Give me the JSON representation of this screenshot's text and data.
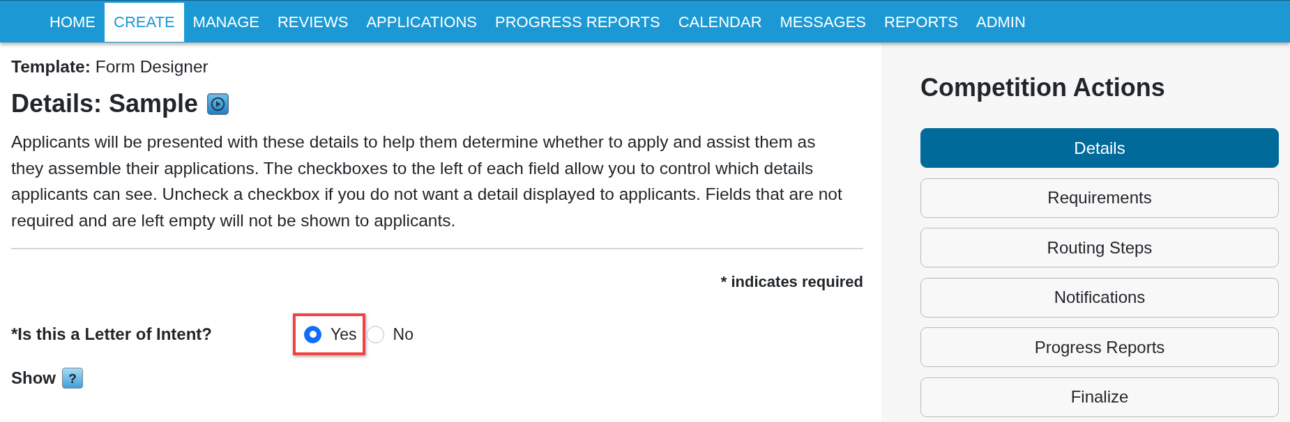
{
  "nav": {
    "items": [
      {
        "label": "HOME",
        "selected": false
      },
      {
        "label": "CREATE",
        "selected": true
      },
      {
        "label": "MANAGE",
        "selected": false
      },
      {
        "label": "REVIEWS",
        "selected": false
      },
      {
        "label": "APPLICATIONS",
        "selected": false
      },
      {
        "label": "PROGRESS REPORTS",
        "selected": false
      },
      {
        "label": "CALENDAR",
        "selected": false
      },
      {
        "label": "MESSAGES",
        "selected": false
      },
      {
        "label": "REPORTS",
        "selected": false
      },
      {
        "label": "ADMIN",
        "selected": false
      }
    ]
  },
  "template": "**Template:** Form Designer",
  "page_title": "Details: Sample",
  "intro": "Applicants will be presented with these details to help them determine whether to apply and assist them as they assemble their applications. The checkboxes to the left of each field allow you to control which details applicants can see. Uncheck a checkbox if you do not want a detail displayed to applicants. Fields that are not required and are left empty will not be shown to applicants.",
  "required_note": "* indicates required",
  "question": {
    "label": "*Is this a Letter of Intent?",
    "options": [
      {
        "label": "Yes",
        "selected": true,
        "highlighted": true
      },
      {
        "label": "No",
        "selected": false,
        "highlighted": false
      }
    ]
  },
  "show": {
    "label": "Show",
    "help": "?"
  },
  "sidebar": {
    "title": "Competition Actions",
    "items": [
      {
        "label": "Details",
        "selected": true
      },
      {
        "label": "Requirements",
        "selected": false
      },
      {
        "label": "Routing Steps",
        "selected": false
      },
      {
        "label": "Notifications",
        "selected": false
      },
      {
        "label": "Progress Reports",
        "selected": false
      },
      {
        "label": "Finalize",
        "selected": false
      }
    ]
  }
}
